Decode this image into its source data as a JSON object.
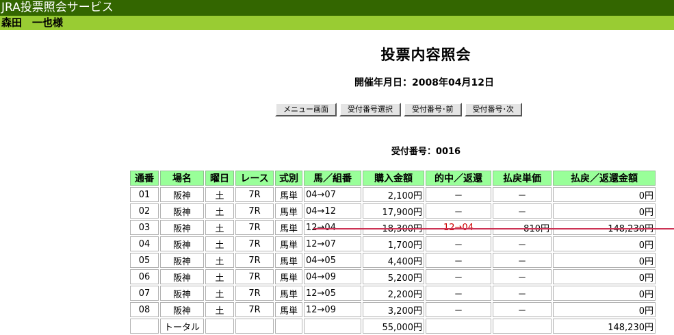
{
  "header": {
    "service_title": "JRA投票照会サービス",
    "user_name": "森田　一也様"
  },
  "page": {
    "title": "投票内容照会",
    "date_line": "開催年月日：2008年04月12日",
    "receipt_line": "受付番号：0016"
  },
  "buttons": {
    "menu": "メニュー画面",
    "select": "受付番号選択",
    "prev": "受付番号･前",
    "next": "受付番号･次"
  },
  "table": {
    "columns": [
      "通番",
      "場名",
      "曜日",
      "レース",
      "式別",
      "馬／組番",
      "購入金額",
      "的中／返還",
      "払戻単価",
      "払戻／返還金額"
    ],
    "rows": [
      {
        "no": "01",
        "venue": "阪神",
        "day": "土",
        "race": "7R",
        "type": "馬単",
        "combo": "04→07",
        "amount": "2,100円",
        "hit": "－",
        "unit": "－",
        "payout": "0円"
      },
      {
        "no": "02",
        "venue": "阪神",
        "day": "土",
        "race": "7R",
        "type": "馬単",
        "combo": "04→12",
        "amount": "17,900円",
        "hit": "－",
        "unit": "－",
        "payout": "0円"
      },
      {
        "no": "03",
        "venue": "阪神",
        "day": "土",
        "race": "7R",
        "type": "馬単",
        "combo": "12→04",
        "amount": "18,300円",
        "hit": "12→04",
        "unit": "810円",
        "payout": "148,230円"
      },
      {
        "no": "04",
        "venue": "阪神",
        "day": "土",
        "race": "7R",
        "type": "馬単",
        "combo": "12→07",
        "amount": "1,700円",
        "hit": "－",
        "unit": "－",
        "payout": "0円"
      },
      {
        "no": "05",
        "venue": "阪神",
        "day": "土",
        "race": "7R",
        "type": "馬単",
        "combo": "04→05",
        "amount": "4,400円",
        "hit": "－",
        "unit": "－",
        "payout": "0円"
      },
      {
        "no": "06",
        "venue": "阪神",
        "day": "土",
        "race": "7R",
        "type": "馬単",
        "combo": "04→09",
        "amount": "5,200円",
        "hit": "－",
        "unit": "－",
        "payout": "0円"
      },
      {
        "no": "07",
        "venue": "阪神",
        "day": "土",
        "race": "7R",
        "type": "馬単",
        "combo": "12→05",
        "amount": "2,200円",
        "hit": "－",
        "unit": "－",
        "payout": "0円"
      },
      {
        "no": "08",
        "venue": "阪神",
        "day": "土",
        "race": "7R",
        "type": "馬単",
        "combo": "12→09",
        "amount": "3,200円",
        "hit": "－",
        "unit": "－",
        "payout": "0円"
      }
    ],
    "total": {
      "label": "トータル",
      "amount": "55,000円",
      "payout": "148,230円"
    }
  },
  "colors": {
    "top_bar": "#336600",
    "user_bar": "#99cc33",
    "header_cell": "#99ff99",
    "hit_text": "#cc0000",
    "hit_line": "#cc3355"
  }
}
